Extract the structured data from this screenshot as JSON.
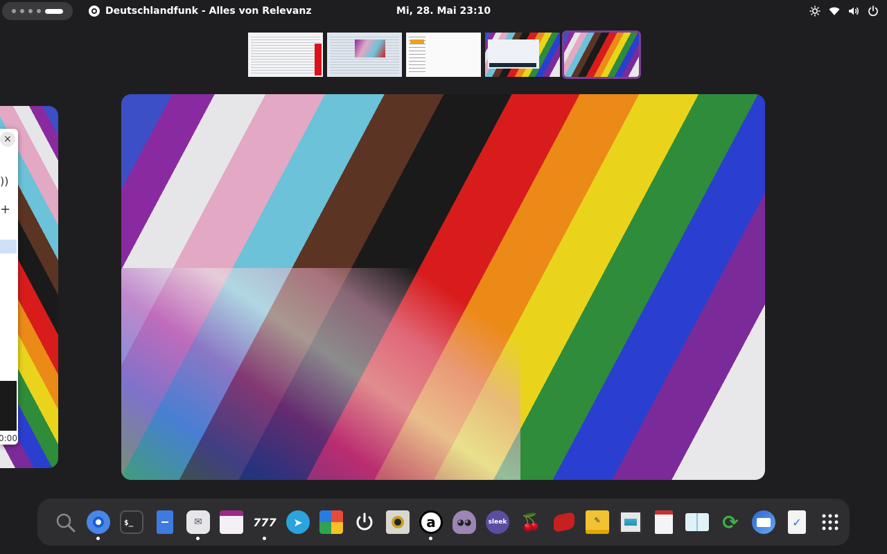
{
  "topbar": {
    "app_name": "Deutschlandfunk - Alles von Relevanz",
    "clock": "Mi, 28. Mai  23:10",
    "tray_icons": [
      "brightness-icon",
      "wifi-icon",
      "volume-icon",
      "power-icon"
    ]
  },
  "side_window": {
    "close": "×",
    "time": "0:00"
  },
  "dock": {
    "items": [
      {
        "name": "search",
        "icon": "search-icon",
        "running": false
      },
      {
        "name": "chromium",
        "icon": "chromium-icon",
        "running": true
      },
      {
        "name": "terminal",
        "icon": "terminal-icon",
        "running": false
      },
      {
        "name": "files",
        "icon": "file-manager-icon",
        "running": false
      },
      {
        "name": "mail-scheduler",
        "icon": "mail-clock-icon",
        "running": true
      },
      {
        "name": "calendar",
        "icon": "calendar-icon",
        "running": false
      },
      {
        "name": "app-777",
        "icon": "stripes-icon",
        "running": true
      },
      {
        "name": "telegram",
        "icon": "telegram-icon",
        "running": false
      },
      {
        "name": "app-grid-colored",
        "icon": "colored-grid-icon",
        "running": false
      },
      {
        "name": "power-app",
        "icon": "power-icon",
        "running": false
      },
      {
        "name": "speaker",
        "icon": "speaker-icon",
        "running": false
      },
      {
        "name": "app-a",
        "icon": "letter-a-icon",
        "running": true
      },
      {
        "name": "ghost",
        "icon": "ghost-icon",
        "running": false
      },
      {
        "name": "sleek",
        "icon": "sleek-icon",
        "label": "sleek",
        "running": false
      },
      {
        "name": "cherry",
        "icon": "cherry-icon",
        "running": false
      },
      {
        "name": "red-book",
        "icon": "red-book-icon",
        "running": false
      },
      {
        "name": "notes",
        "icon": "notepad-icon",
        "running": false
      },
      {
        "name": "screen",
        "icon": "screen-icon",
        "running": false
      },
      {
        "name": "news",
        "icon": "newspaper-icon",
        "running": false
      },
      {
        "name": "reader",
        "icon": "open-book-icon",
        "running": false
      },
      {
        "name": "sync",
        "icon": "sync-icon",
        "running": false
      },
      {
        "name": "thunderbird",
        "icon": "mail-icon",
        "running": false
      },
      {
        "name": "tasks",
        "icon": "checklist-icon",
        "running": false
      },
      {
        "name": "show-apps",
        "icon": "app-grid-icon",
        "running": false
      }
    ]
  }
}
